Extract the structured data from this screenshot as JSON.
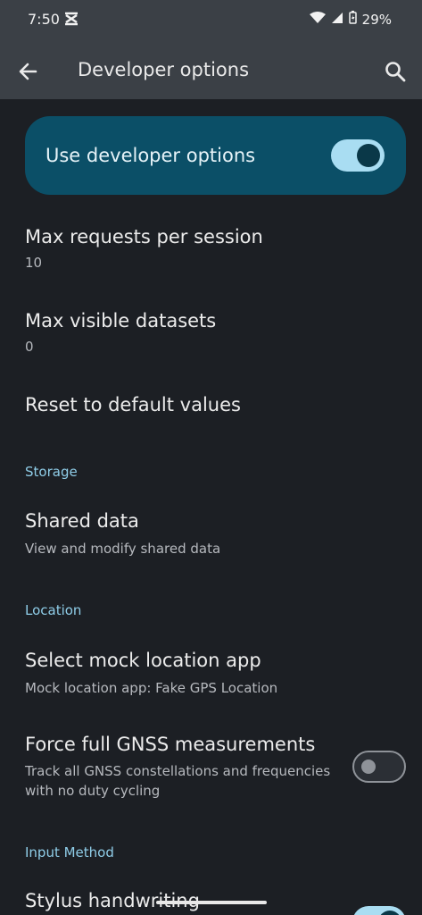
{
  "status_bar": {
    "time": "7:50",
    "battery": "29%",
    "icons": [
      "notification-icon",
      "wifi-icon",
      "signal-icon",
      "battery-icon"
    ]
  },
  "app_bar": {
    "title": "Developer options",
    "back_icon": "back-arrow-icon",
    "search_icon": "search-icon"
  },
  "master_switch": {
    "label": "Use developer options",
    "on": true
  },
  "items": [
    {
      "title": "Max requests per session",
      "subtitle": "10"
    },
    {
      "title": "Max visible datasets",
      "subtitle": "0"
    },
    {
      "title": "Reset to default values"
    }
  ],
  "sections": {
    "storage": {
      "header": "Storage",
      "items": [
        {
          "title": "Shared data",
          "subtitle": "View and modify shared data"
        }
      ]
    },
    "location": {
      "header": "Location",
      "items": [
        {
          "title": "Select mock location app",
          "subtitle": "Mock location app: Fake GPS Location"
        },
        {
          "title": "Force full GNSS measurements",
          "subtitle_line1": "Track all GNSS constellations and frequencies",
          "subtitle_line2": "with no duty cycling",
          "toggle_on": false
        }
      ]
    },
    "input_method": {
      "header": "Input Method",
      "items": [
        {
          "title": "Stylus handwriting",
          "toggle_on": true
        }
      ]
    }
  },
  "colors": {
    "background": "#1c1f24",
    "app_bar": "#3b4046",
    "master_card": "#0b4f67",
    "accent": "#8fcde8",
    "toggle_on_track": "#a9ddf2"
  }
}
